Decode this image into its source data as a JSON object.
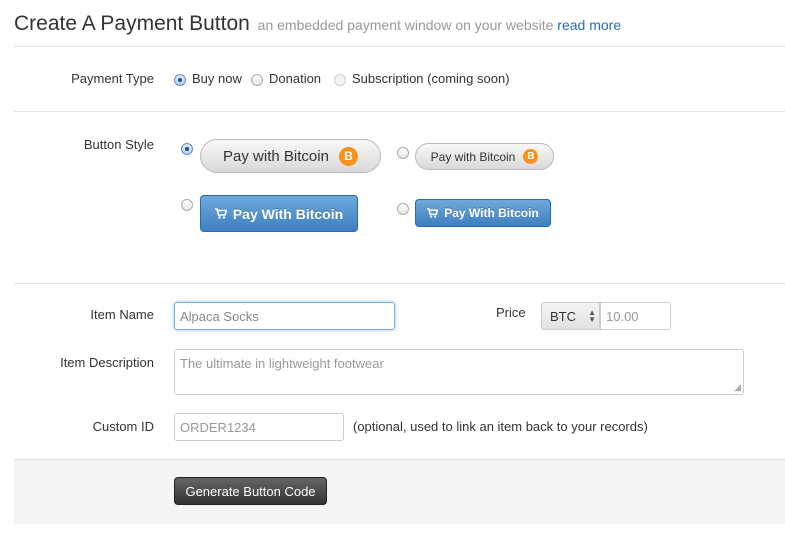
{
  "header": {
    "title": "Create A Payment Button",
    "subtitle": "an embedded payment window on your website",
    "read_more": "read more"
  },
  "payment_type": {
    "label": "Payment Type",
    "options": [
      {
        "label": "Buy now",
        "selected": true,
        "disabled": false
      },
      {
        "label": "Donation",
        "selected": false,
        "disabled": false
      },
      {
        "label": "Subscription (coming soon)",
        "selected": false,
        "disabled": true
      }
    ]
  },
  "button_style": {
    "label": "Button Style",
    "options": [
      {
        "text": "Pay with Bitcoin",
        "style": "gray-large",
        "icon": "bitcoin-coin-icon",
        "selected": true
      },
      {
        "text": "Pay with Bitcoin",
        "style": "gray-small",
        "icon": "bitcoin-coin-icon",
        "selected": false
      },
      {
        "text": "Pay With Bitcoin",
        "style": "blue-large",
        "icon": "cart-icon",
        "selected": false
      },
      {
        "text": "Pay With Bitcoin",
        "style": "blue-small",
        "icon": "cart-icon",
        "selected": false
      }
    ],
    "coin_glyph": "B"
  },
  "form": {
    "item_name": {
      "label": "Item Name",
      "placeholder": "Alpaca Socks"
    },
    "price": {
      "label": "Price",
      "currency": "BTC",
      "placeholder": "10.00"
    },
    "item_description": {
      "label": "Item Description",
      "placeholder": "The ultimate in lightweight footwear"
    },
    "custom_id": {
      "label": "Custom ID",
      "placeholder": "ORDER1234",
      "help": "(optional, used to link an item back to your records)"
    }
  },
  "actions": {
    "generate_label": "Generate Button Code"
  },
  "colors": {
    "accent": "#2a6db0",
    "bitcoin": "#f7931a",
    "blue_button": "#4a8ac9"
  }
}
